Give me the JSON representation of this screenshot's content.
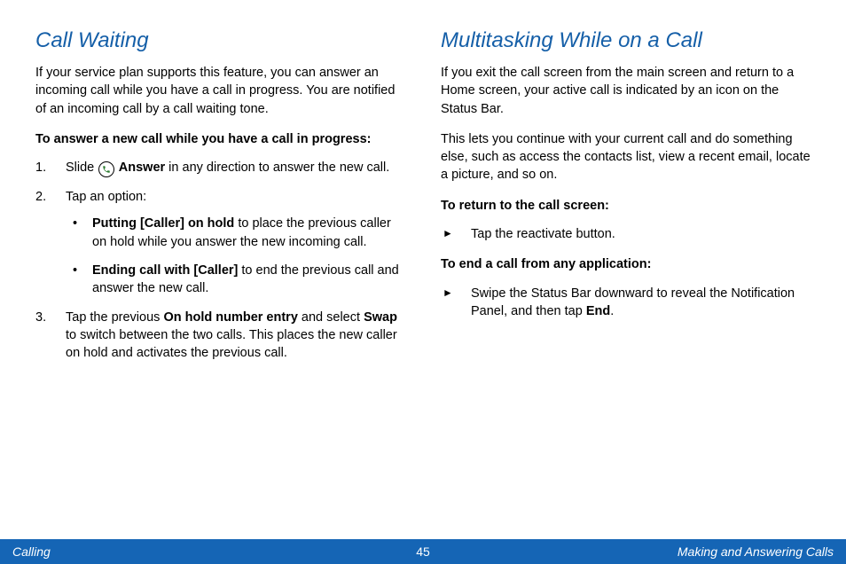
{
  "left": {
    "heading": "Call Waiting",
    "intro": "If your service plan supports this feature, you can answer an incoming call while you have a call in progress. You are notified of an incoming call by a call waiting tone.",
    "lead": "To answer a new call while you have a call in progress:",
    "step1_a": "Slide ",
    "step1_b": " Answer",
    "step1_c": " in any direction to answer the new call.",
    "step2": "Tap an option:",
    "opt1_b": "Putting [Caller] on hold",
    "opt1_t": " to place the previous caller on hold while you answer the new incoming call.",
    "opt2_b": "Ending call with [Caller]",
    "opt2_t": " to end the previous call and answer the new call.",
    "step3_a": "Tap the previous ",
    "step3_b": "On hold number entry",
    "step3_c": " and select ",
    "step3_d": "Swap",
    "step3_e": " to switch between the two calls. This places the new caller on hold and activates the previous call."
  },
  "right": {
    "heading": "Multitasking While on a Call",
    "p1": "If you exit the call screen from the main screen and return to a Home screen, your active call is indicated by an icon on the Status Bar.",
    "p2": "This lets you continue with your current call and do something else, such as access the contacts list, view a recent email, locate a picture, and so on.",
    "lead1": "To return to the call screen:",
    "r1": "Tap the reactivate button.",
    "lead2": "To end a call from any application:",
    "e1_a": "Swipe the Status Bar downward to reveal the Notification Panel, and then tap ",
    "e1_b": "End",
    "e1_c": "."
  },
  "footer": {
    "left": "Calling",
    "page": "45",
    "right": "Making and Answering Calls"
  }
}
